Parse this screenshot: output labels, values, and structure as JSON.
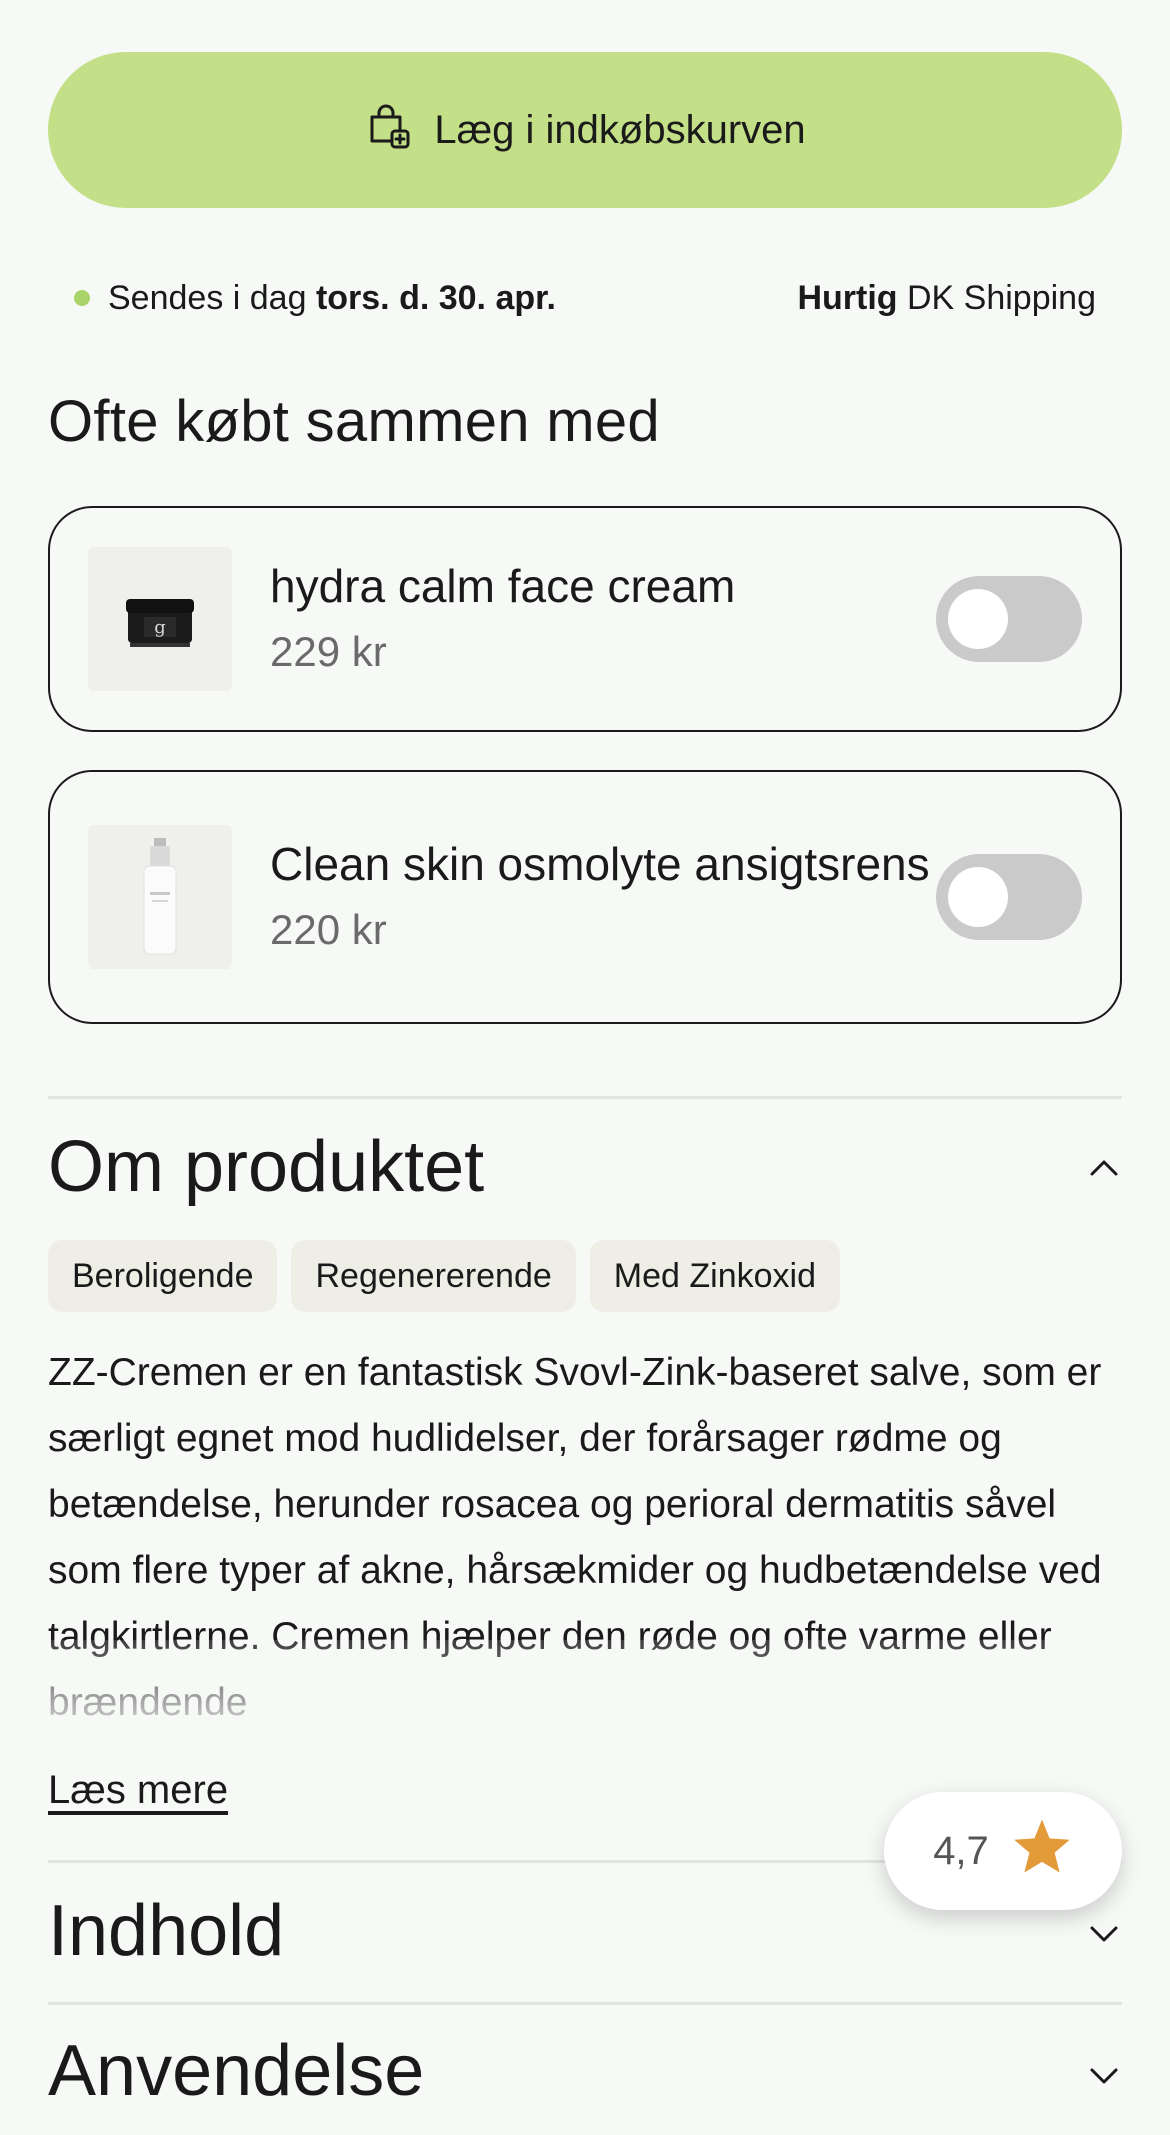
{
  "cart_button": {
    "label": "Læg i indkøbskurven",
    "icon": "shopping-bag-plus-icon"
  },
  "shipping": {
    "status_color": "#a8d46a",
    "prefix": "Sendes i dag",
    "date": "tors. d. 30. apr.",
    "speed": "Hurtig",
    "carrier": "DK Shipping"
  },
  "bought_together": {
    "title": "Ofte købt sammen med",
    "items": [
      {
        "name": "hydra calm face cream",
        "price": "229 kr",
        "image": "cream-jar-image",
        "toggle_on": false
      },
      {
        "name": "Clean skin osmolyte ansigtsrens",
        "price": "220 kr",
        "image": "pump-bottle-image",
        "toggle_on": false
      }
    ]
  },
  "about": {
    "title": "Om produktet",
    "expanded": true,
    "tags": [
      "Beroligende",
      "Regenererende",
      "Med Zinkoxid"
    ],
    "description": "ZZ-Cremen er en fantastisk Svovl-Zink-baseret salve, som er særligt egnet mod hudlidelser, der forårsager rødme og betændelse, herunder rosacea og perioral dermatitis såvel som flere typer af akne, hårsækmider og hudbetændelse ved talgkirtlerne. Cremen hjælper den røde og ofte varme eller brændende",
    "read_more": "Læs mere"
  },
  "accordions": [
    {
      "title": "Indhold",
      "expanded": false
    },
    {
      "title": "Anvendelse",
      "expanded": false
    }
  ],
  "rating": {
    "value": "4,7",
    "star_color": "#e39b3a"
  },
  "colors": {
    "accent_green": "#c3df87",
    "background": "#f7f9f7"
  }
}
